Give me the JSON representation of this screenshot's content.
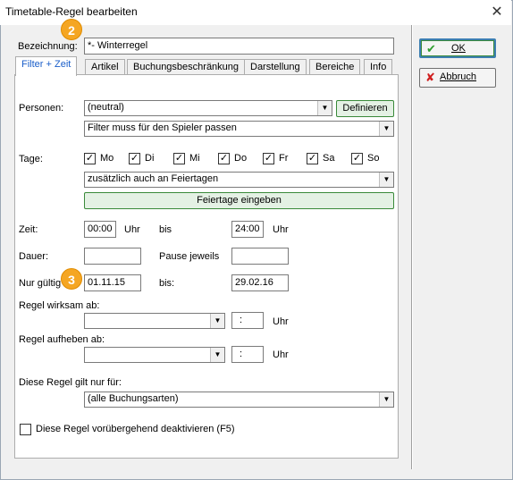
{
  "window": {
    "title": "Timetable-Regel bearbeiten",
    "close_glyph": "✕"
  },
  "bezeichnung": {
    "label": "Bezeichnung:",
    "value": "*- Winterregel"
  },
  "tabs": [
    {
      "label": "Filter + Zeit"
    },
    {
      "label": "Artikel"
    },
    {
      "label": "Buchungsbeschränkung"
    },
    {
      "label": "Darstellung"
    },
    {
      "label": "Bereiche"
    },
    {
      "label": "Info"
    }
  ],
  "personen": {
    "label": "Personen:",
    "select_value": "(neutral)",
    "button": "Definieren",
    "filter_value": "Filter muss für den Spieler passen"
  },
  "tage": {
    "label": "Tage:",
    "days": [
      {
        "label": "Mo",
        "checked": true
      },
      {
        "label": "Di",
        "checked": true
      },
      {
        "label": "Mi",
        "checked": true
      },
      {
        "label": "Do",
        "checked": true
      },
      {
        "label": "Fr",
        "checked": true
      },
      {
        "label": "Sa",
        "checked": true
      },
      {
        "label": "So",
        "checked": true
      }
    ],
    "holiday_select": "zusätzlich auch an Feiertagen",
    "holiday_button": "Feiertage eingeben"
  },
  "zeit": {
    "label": "Zeit:",
    "from": "00:00",
    "unit": "Uhr",
    "bis": "bis",
    "to": "24:00"
  },
  "dauer": {
    "label": "Dauer:",
    "pause_label": "Pause jeweils"
  },
  "gueltig": {
    "label": "Nur gültig",
    "from": "01.11.15",
    "bis": "bis:",
    "to": "29.02.16"
  },
  "wirksam": {
    "label": "Regel wirksam ab:",
    "time_sep": ":",
    "unit": "Uhr"
  },
  "aufheben": {
    "label": "Regel aufheben ab:",
    "time_sep": ":",
    "unit": "Uhr"
  },
  "gilt": {
    "label": "Diese Regel gilt nur für:",
    "select_value": "(alle Buchungsarten)"
  },
  "deaktivieren": {
    "label": "Diese Regel vorübergehend deaktivieren (F5)",
    "checked": false
  },
  "buttons": {
    "ok": "OK",
    "cancel": "Abbruch"
  },
  "badges": {
    "b1": "2",
    "b2": "3"
  },
  "colors": {
    "badge": "#f5a623",
    "tab_active_text": "#1a5ec9",
    "ok_icon": "#2e9e2e",
    "cancel_icon": "#d02020"
  }
}
